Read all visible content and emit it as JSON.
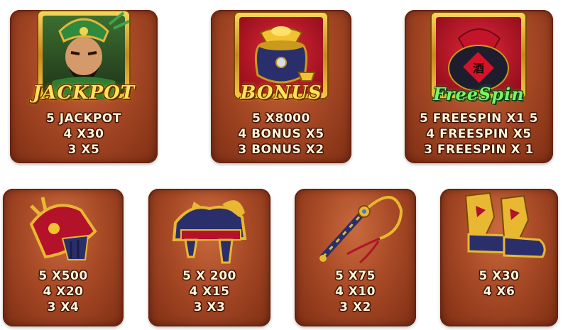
{
  "special_symbols": [
    {
      "id": "jackpot",
      "badge": "JACKPOT",
      "icon": "warrior-general-icon",
      "payouts": [
        "5 JACKPOT",
        "4 X30",
        "3 X5"
      ]
    },
    {
      "id": "bonus",
      "badge": "BONUS",
      "icon": "gold-pot-icon",
      "payouts": [
        "5 X8000",
        "4 BONUS X5",
        "3 BONUS X2"
      ]
    },
    {
      "id": "freespin",
      "badge": "FreeSpin",
      "icon": "wine-jar-icon",
      "payouts": [
        "5 FREESPIN X1 5",
        "4 FREESPIN X5",
        "3 FREESPIN X 1"
      ]
    }
  ],
  "regular_symbols": [
    {
      "id": "helmet",
      "icon": "armor-helmet-icon",
      "payouts": [
        "5 X500",
        "4 X20",
        "3 X4"
      ]
    },
    {
      "id": "saddle",
      "icon": "war-saddle-icon",
      "payouts": [
        "5 X 200",
        "4 X15",
        "3 X3"
      ]
    },
    {
      "id": "whip",
      "icon": "horse-whip-icon",
      "payouts": [
        "5 X75",
        "4 X10",
        "3 X2"
      ]
    },
    {
      "id": "boots",
      "icon": "war-boots-icon",
      "payouts": [
        "5 X30",
        "4 X6"
      ]
    }
  ],
  "colors": {
    "card_base": "#a84a26",
    "card_dark": "#7f2e14",
    "text": "#fff6d8",
    "gold": "#f7d65b",
    "navy": "#2a2f6b",
    "crimson": "#b3122a"
  }
}
